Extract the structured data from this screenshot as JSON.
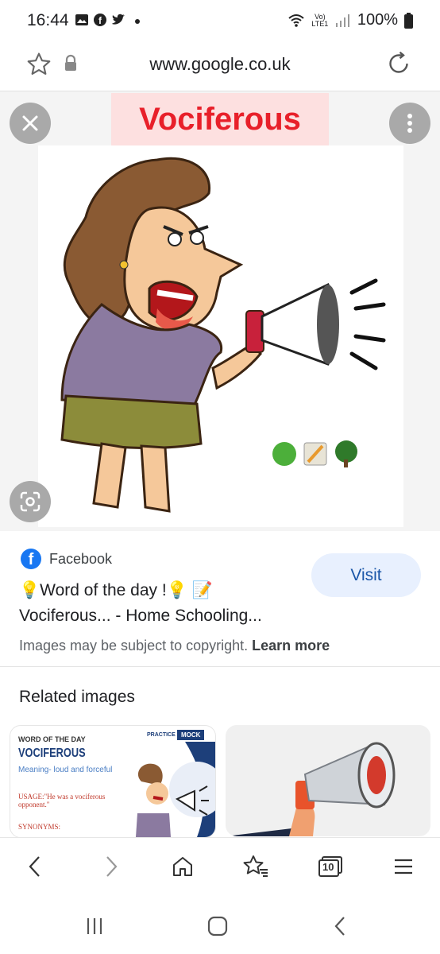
{
  "status_bar": {
    "time": "16:44",
    "network": "Vo) LTE1",
    "battery": "100%"
  },
  "url_bar": {
    "url": "www.google.co.uk"
  },
  "viewer": {
    "image_word": "Vociferous"
  },
  "result": {
    "source": "Facebook",
    "title_line1": "💡Word of the day !💡 📝",
    "title_line2": "Vociferous... - Home Schooling...",
    "visit_label": "Visit",
    "copyright_text": "Images may be subject to copyright. ",
    "learn_more": "Learn more"
  },
  "related": {
    "title": "Related images",
    "card1": {
      "kicker": "WORD OF THE DAY",
      "word": "VOCIFEROUS",
      "meaning": "Meaning- loud and forceful",
      "usage": "USAGE:\"He was a vociferous opponent.\"",
      "synonyms": "SYNONYMS:",
      "practice": "PRACTICE",
      "mock": "MOCK"
    }
  },
  "bottom_nav": {
    "tabs_count": "10"
  },
  "colors": {
    "word_red": "#e8202a",
    "facebook_blue": "#1877f2",
    "visit_bg": "#e8f0fe"
  }
}
